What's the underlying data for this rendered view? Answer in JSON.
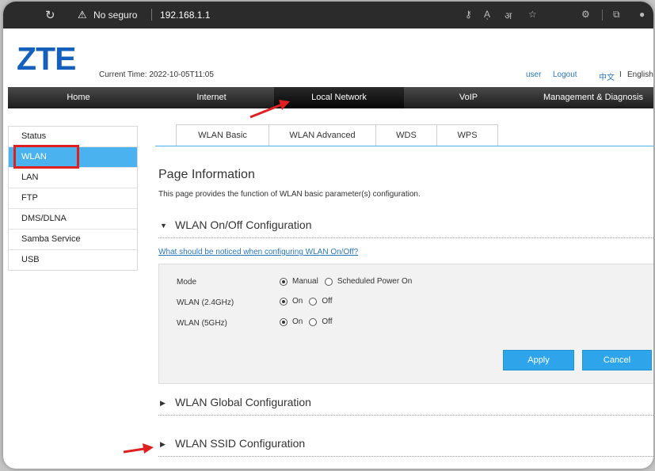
{
  "browser": {
    "security_label": "No seguro",
    "url": "192.168.1.1"
  },
  "header": {
    "logo": "ZTE",
    "current_time_label": "Current Time:",
    "current_time_value": "2022-10-05T11:05",
    "user": "user",
    "logout": "Logout",
    "lang_zh": "中文",
    "lang_separator": "I",
    "lang_en": "English"
  },
  "nav": {
    "items": [
      "Home",
      "Internet",
      "Local Network",
      "VoIP",
      "Management & Diagnosis"
    ],
    "active": "Local Network"
  },
  "sidebar": {
    "items": [
      "Status",
      "WLAN",
      "LAN",
      "FTP",
      "DMS/DLNA",
      "Samba Service",
      "USB"
    ],
    "active": "WLAN"
  },
  "tabs": {
    "items": [
      "WLAN Basic",
      "WLAN Advanced",
      "WDS",
      "WPS"
    ],
    "active": "WLAN Basic"
  },
  "page": {
    "title": "Page Information",
    "description": "This page provides the function of WLAN basic parameter(s) configuration."
  },
  "onoff": {
    "section_title": "WLAN On/Off Configuration",
    "notice_link": "What should be noticed when configuring WLAN On/Off?",
    "mode_label": "Mode",
    "mode_options": [
      "Manual",
      "Scheduled Power On"
    ],
    "mode_selected": "Manual",
    "wlan24_label": "WLAN (2.4GHz)",
    "wlan5_label": "WLAN (5GHz)",
    "on_label": "On",
    "off_label": "Off",
    "wlan24_selected": "On",
    "wlan5_selected": "On",
    "apply": "Apply",
    "cancel": "Cancel"
  },
  "global": {
    "section_title": "WLAN Global Configuration"
  },
  "ssid": {
    "section_title": "WLAN SSID Configuration"
  },
  "colors": {
    "accent": "#2ea5ea",
    "sidebar_active": "#4bb2f0",
    "logo": "#1560bd",
    "annotation_red": "#e02020",
    "link": "#2a77bd"
  }
}
